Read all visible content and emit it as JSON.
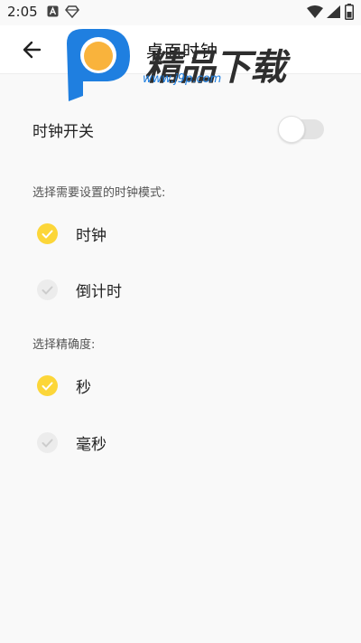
{
  "status_bar": {
    "time": "2:05"
  },
  "header": {
    "title": "桌面时钟"
  },
  "watermark": {
    "text": "精品下载",
    "url": "www.j9p.com"
  },
  "settings": {
    "clock_switch": {
      "label": "时钟开关",
      "enabled": false
    },
    "mode_section": {
      "label": "选择需要设置的时钟模式:",
      "options": [
        {
          "label": "时钟",
          "selected": true
        },
        {
          "label": "倒计时",
          "selected": false
        }
      ]
    },
    "precision_section": {
      "label": "选择精确度:",
      "options": [
        {
          "label": "秒",
          "selected": true
        },
        {
          "label": "毫秒",
          "selected": false
        }
      ]
    }
  },
  "colors": {
    "accent": "#fcd639",
    "unselected": "#ececec",
    "watermark_blue": "#1f7fe0",
    "watermark_orange": "#f9b33c"
  }
}
